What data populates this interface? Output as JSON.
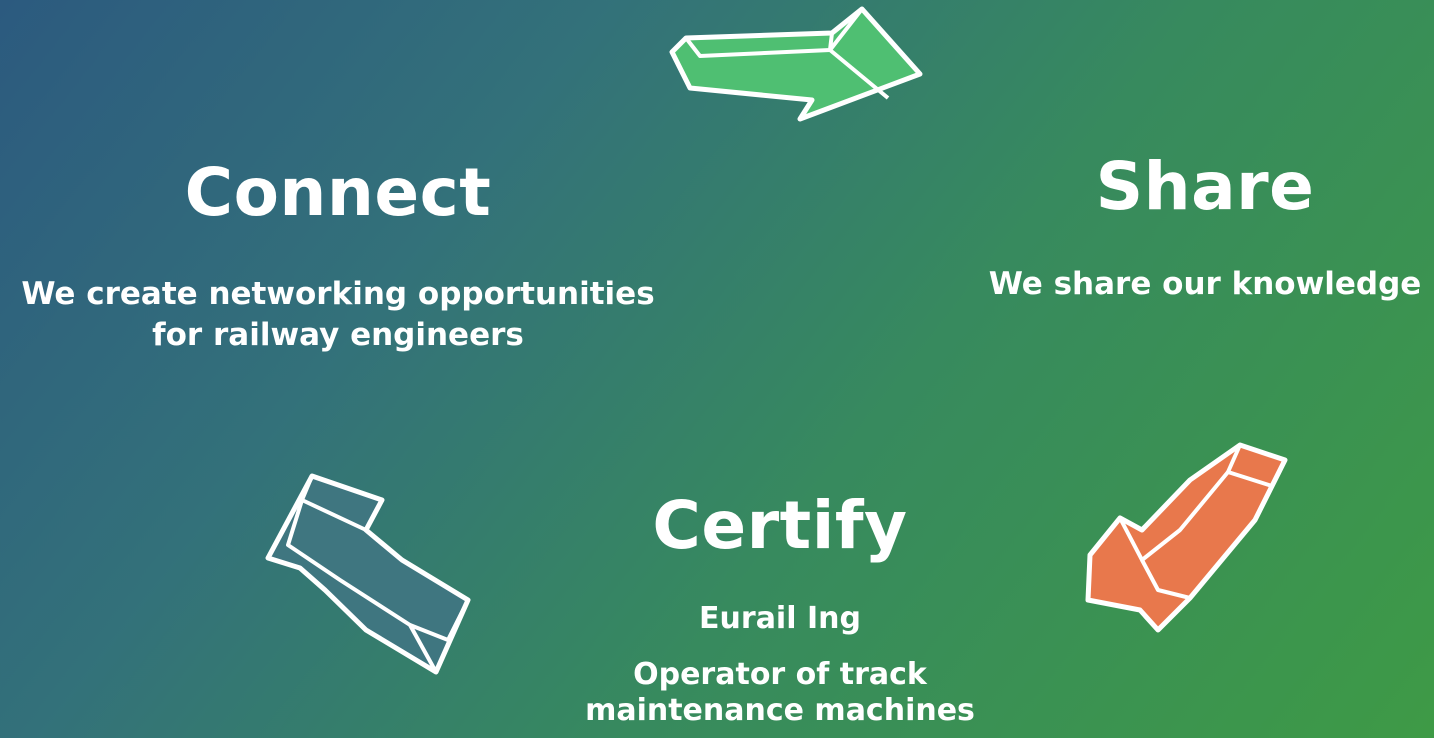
{
  "steps": {
    "connect": {
      "title": "Connect",
      "lines": [
        "We create networking opportunities",
        "for railway engineers"
      ]
    },
    "share": {
      "title": "Share",
      "lines": [
        "We share our knowledge"
      ]
    },
    "certify": {
      "title": "Certify",
      "lines": [
        "Eurail Ing",
        "Operator of track",
        "maintenance machines"
      ]
    }
  },
  "arrows": [
    {
      "name": "arrow-connect-to-share",
      "color": "#4fbf72"
    },
    {
      "name": "arrow-share-to-certify",
      "color": "#e8784c"
    },
    {
      "name": "arrow-certify-to-connect",
      "color": "#3f7680"
    }
  ],
  "colors": {
    "background_start": "#2c5a7f",
    "background_end": "#3e9a46",
    "text": "#ffffff"
  }
}
